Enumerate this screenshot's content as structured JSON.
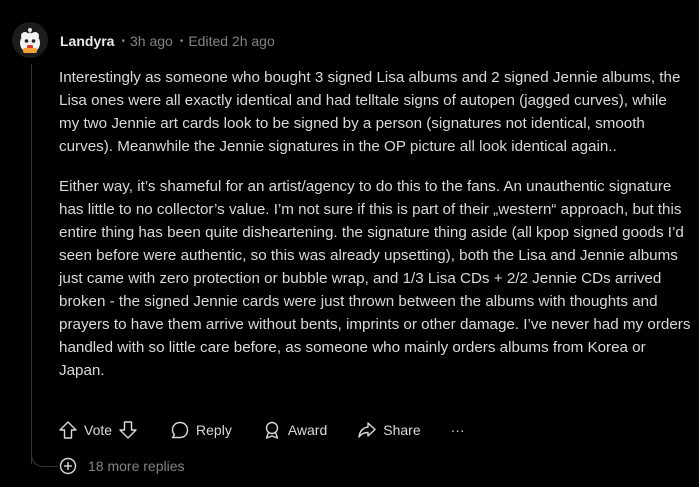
{
  "comment": {
    "author": "Landyra",
    "posted": "3h ago",
    "edited": "Edited 2h ago",
    "paragraphs": [
      "Interestingly as someone who bought 3 signed Lisa albums and 2 signed Jennie albums, the Lisa ones were all exactly identical and had telltale signs of autopen (jagged curves), while my two Jennie art cards look to be signed by a person (signatures not identical, smooth curves). Meanwhile the Jennie signatures in the OP picture all look identical again..",
      "Either way, it’s shameful for an artist/agency to do this to the fans. An unauthentic signature has little to no collector’s value. I’m not sure if this is part of their „western“ approach, but this entire thing has been quite disheartening. the signature thing aside (all kpop signed goods I’d seen before were authentic, so this was already upsetting), both the Lisa and Jennie albums just came with zero protection or bubble wrap, and 1/3 Lisa CDs + 2/2 Jennie CDs arrived broken - the signed Jennie cards were just thrown between the albums with thoughts and prayers to have them arrive without bents, imprints or other damage. I’ve never had my orders handled with so little care before, as someone who mainly orders albums from Korea or Japan."
    ]
  },
  "actions": {
    "vote_label": "Vote",
    "reply_label": "Reply",
    "award_label": "Award",
    "share_label": "Share",
    "more_label": "···"
  },
  "replies": {
    "more_label": "18 more replies"
  },
  "icons": {
    "upvote": "upvote-icon",
    "downvote": "downvote-icon",
    "reply": "reply-bubble-icon",
    "award": "award-icon",
    "share": "share-icon",
    "expand": "plus-circle-icon",
    "avatar": "snoo-avatar"
  },
  "colors": {
    "background": "#000000",
    "text": "#d7dadc",
    "muted": "#818384",
    "thread_line": "#343536"
  }
}
